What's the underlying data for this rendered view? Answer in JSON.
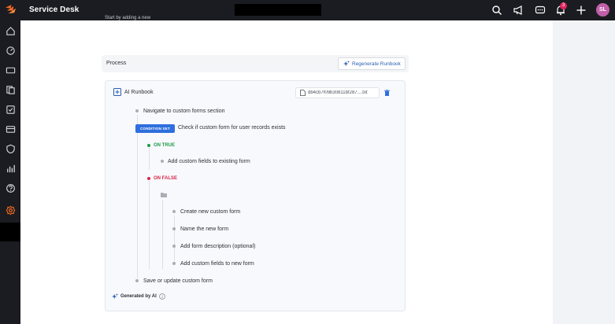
{
  "header": {
    "app_title": "Service Desk",
    "notification_count": "3",
    "avatar_initials": "SL",
    "icons": [
      "search-icon",
      "megaphone-icon",
      "chat-icon",
      "bell-icon",
      "plus-icon"
    ]
  },
  "sidebar": {
    "items": [
      {
        "name": "home-icon"
      },
      {
        "name": "dashboard-icon"
      },
      {
        "name": "ticket-icon"
      },
      {
        "name": "documents-icon"
      },
      {
        "name": "tasks-icon"
      },
      {
        "name": "card-icon"
      },
      {
        "name": "shield-icon"
      },
      {
        "name": "reports-icon"
      },
      {
        "name": "help-icon"
      },
      {
        "name": "settings-icon",
        "active": true
      }
    ]
  },
  "main": {
    "faded_text": "Start by adding a new",
    "process_label": "Process",
    "regenerate_label": "Regenerate Runbook"
  },
  "runbook": {
    "title": "AI Runbook",
    "file_name": "db4cb7f09b30811bf287....txt",
    "steps": {
      "s1": "Navigate to custom forms section",
      "condition_badge": "CONDITION SET",
      "condition": "Check if custom form for user records exists",
      "on_true": "ON TRUE",
      "true_step": "Add custom fields to existing form",
      "on_false": "ON FALSE",
      "false_steps": [
        "Create new custom form",
        "Name the new form",
        "Add form description (optional)",
        "Add custom fields to new form"
      ],
      "s_last": "Save or update custom form"
    },
    "generated_by": "Generated by AI"
  },
  "colors": {
    "topbar": "#1b1c21",
    "accent": "#2f6fde",
    "true": "#1a9b46",
    "false": "#d8264a",
    "active_nav": "#f26a21"
  }
}
